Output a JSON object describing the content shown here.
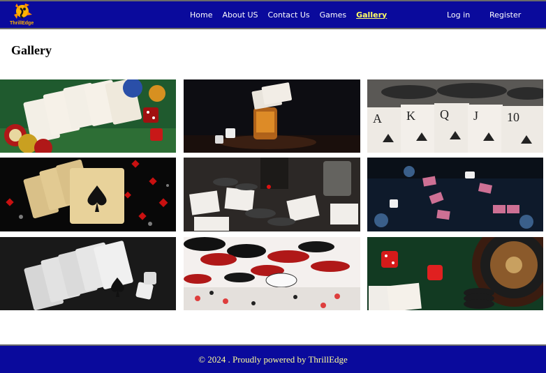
{
  "header": {
    "logo_text": "ThrillEdge",
    "nav": [
      {
        "label": "Home"
      },
      {
        "label": "About US"
      },
      {
        "label": "Contact Us"
      },
      {
        "label": "Games"
      },
      {
        "label": "Gallery",
        "active": true
      }
    ],
    "auth": {
      "login": "Log in",
      "register": "Register"
    }
  },
  "main": {
    "title": "Gallery",
    "images": [
      {
        "subject": "cards, chips and dice on green felt"
      },
      {
        "subject": "dice and glass on dark table"
      },
      {
        "subject": "fanned playing cards close-up"
      },
      {
        "subject": "golden ace of spades royal flush"
      },
      {
        "subject": "cards and chips near whisky bottle"
      },
      {
        "subject": "dark casino table with dice"
      },
      {
        "subject": "black and white royal flush with dice"
      },
      {
        "subject": "chips and cards on white"
      },
      {
        "subject": "roulette wheel, dice and chips"
      }
    ]
  },
  "footer": {
    "text": "© 2024 . Proudly powered by ThrillEdge"
  },
  "colors": {
    "header_bg": "#0a0a9c",
    "active_link": "#ffff66",
    "footer_text": "#ffff9a"
  }
}
